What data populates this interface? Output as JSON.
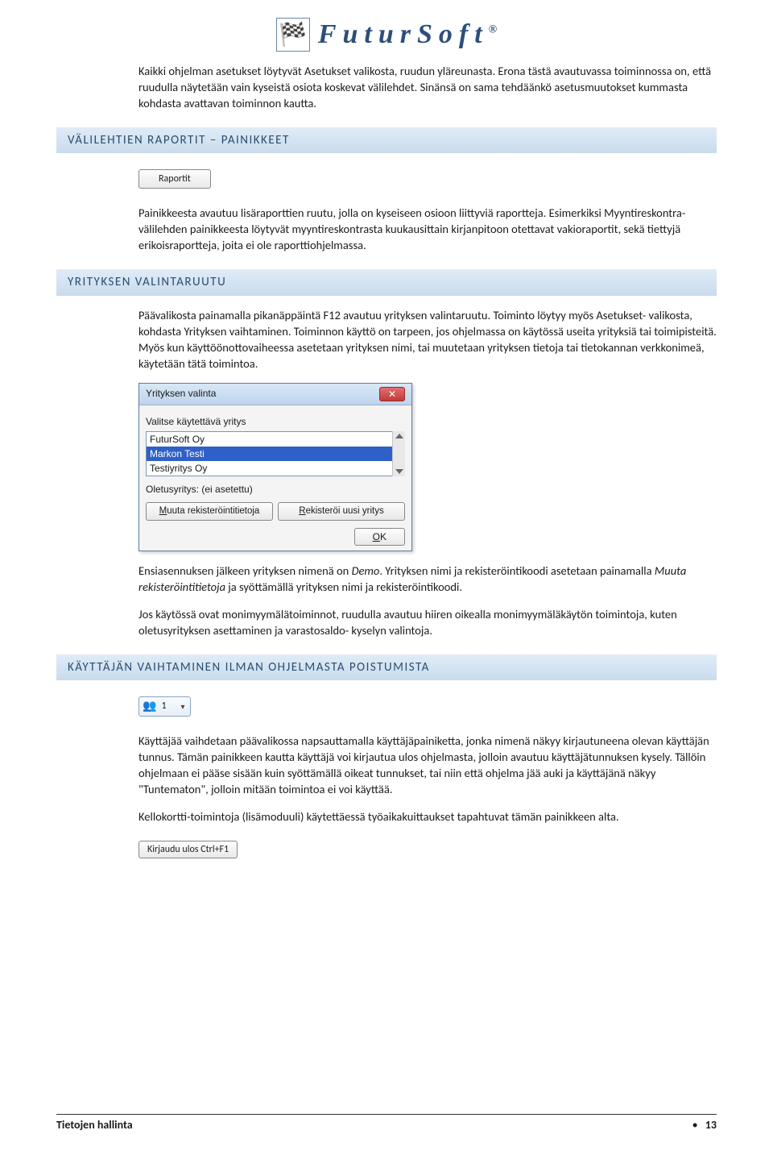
{
  "logo_text": "FuturSoft",
  "logo_reg": "®",
  "intro_paragraph": "Kaikki ohjelman asetukset löytyvät Asetukset valikosta, ruudun yläreunasta. Erona tästä avautuvassa toiminnossa on, että ruudulla näytetään vain kyseistä osiota koskevat välilehdet. Sinänsä on sama tehdäänkö asetusmuutokset kummasta kohdasta avattavan toiminnon kautta.",
  "heading_1": "VÄLILEHTIEN RAPORTIT – PAINIKKEET",
  "raportit_button": "Raportit",
  "raportit_paragraph": "Painikkeesta avautuu lisäraporttien ruutu, jolla on kyseiseen osioon liittyviä raportteja. Esimerkiksi Myyntireskontra- välilehden painikkeesta löytyvät myyntireskontrasta kuukausittain kirjanpitoon otettavat vakioraportit, sekä tiettyjä erikoisraportteja, joita ei ole raporttiohjelmassa.",
  "heading_2": "YRITYKSEN VALINTARUUTU",
  "yritys_paragraph_1": "Päävalikosta painamalla pikanäppäintä F12 avautuu yrityksen valintaruutu. Toiminto löytyy myös Asetukset- valikosta, kohdasta Yrityksen vaihtaminen. Toiminnon käyttö on tarpeen, jos ohjelmassa on käytössä useita yrityksiä tai toimipisteitä. Myös kun käyttöönottovaiheessa asetetaan yrityksen nimi, tai muutetaan yrityksen tietoja tai tietokannan verkkonimeä, käytetään tätä toimintoa.",
  "dialog": {
    "title": "Yrityksen valinta",
    "label": "Valitse käytettävä yritys",
    "items": [
      "FuturSoft Oy",
      "Markon Testi",
      "Testiyritys Oy"
    ],
    "default_label": "Oletusyritys: (ei asetettu)",
    "btn_modify": "Muuta rekisteröintitietoja",
    "btn_register": "Rekisteröi uusi yritys",
    "btn_ok": "OK"
  },
  "yritys_paragraph_2": "Ensiasennuksen jälkeen yrityksen nimenä on Demo. Yrityksen nimi ja rekisteröintikoodi asetetaan painamalla Muuta rekisteröintitietoja ja syöttämällä yrityksen nimi ja rekisteröintikoodi.",
  "yritys_paragraph_3": "Jos käytössä ovat monimyymälätoiminnot, ruudulla avautuu hiiren oikealla monimyymäläkäytön toimintoja, kuten oletusyrityksen asettaminen ja varastosaldo- kyselyn valintoja.",
  "heading_3": "KÄYTTÄJÄN VAIHTAMINEN ILMAN OHJELMASTA POISTUMISTA",
  "user_switch_label": "1",
  "kayttaja_paragraph_1": "Käyttäjää vaihdetaan päävalikossa napsauttamalla käyttäjäpainiketta, jonka nimenä näkyy kirjautuneena olevan käyttäjän tunnus. Tämän painikkeen kautta käyttäjä voi kirjautua ulos ohjelmasta, jolloin avautuu käyttäjätunnuksen kysely. Tällöin ohjelmaan ei pääse sisään kuin syöttämällä oikeat tunnukset, tai niin että ohjelma jää auki ja käyttäjänä näkyy \"Tuntematon\", jolloin mitään toimintoa ei voi käyttää.",
  "kayttaja_paragraph_2": "Kellokortti-toimintoja (lisämoduuli) käytettäessä työaikakuittaukset tapahtuvat tämän painikkeen alta.",
  "kirjaudu_button": "Kirjaudu ulos Ctrl+F1",
  "footer_left": "Tietojen hallinta",
  "footer_bullet": "•",
  "footer_page": "13"
}
